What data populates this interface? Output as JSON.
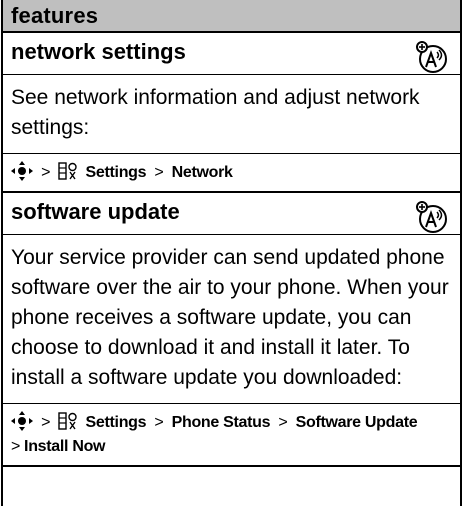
{
  "header": {
    "title": "features"
  },
  "sections": [
    {
      "title": "network settings",
      "body": "See network information and adjust network settings:",
      "path": {
        "separator": ">",
        "items": [
          "Settings",
          "Network"
        ]
      }
    },
    {
      "title": "software update",
      "body": "Your service provider can send updated phone software over the air to your phone. When your phone receives a software update, you can choose to download it and install it later. To install a software update you downloaded:",
      "path": {
        "separator": ">",
        "items": [
          "Settings",
          "Phone Status",
          "Software Update",
          "Install Now"
        ]
      }
    }
  ],
  "icons": {
    "network_feature": "network-feature-icon",
    "nav_key": "nav-key-icon",
    "settings": "settings-icon"
  },
  "colors": {
    "header_band": "#bfbfbf",
    "text": "#000000",
    "rule": "#000000"
  }
}
